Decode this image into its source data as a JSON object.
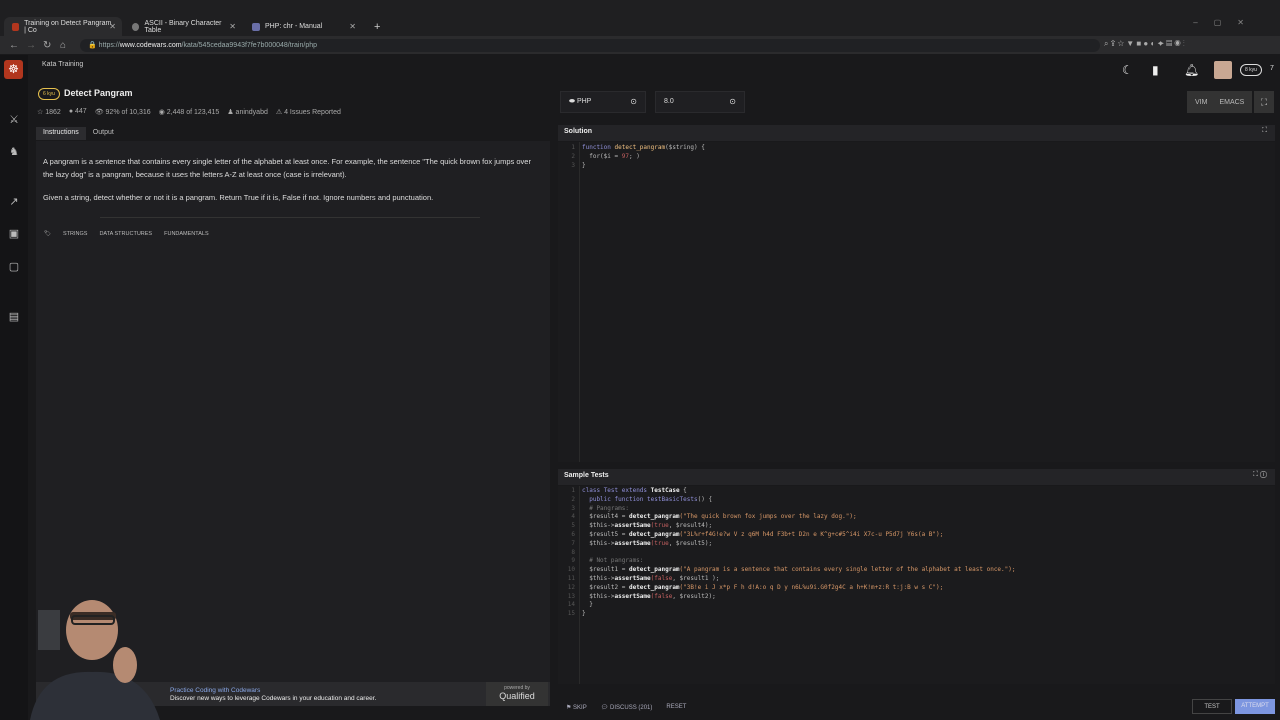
{
  "browser": {
    "tabs": [
      {
        "title": "Training on Detect Pangram | Co"
      },
      {
        "title": "ASCII - Binary Character Table"
      },
      {
        "title": "PHP: chr - Manual"
      }
    ],
    "url_prefix": "https://",
    "url_host": "www.codewars.com",
    "url_path": "/kata/545cedaa9943f7fe7b000048/train/php"
  },
  "header": {
    "section": "Kata Training",
    "user_rank": "8 kyu",
    "honor": "7"
  },
  "kata": {
    "rank": "6 kyu",
    "title": "Detect Pangram",
    "stars": "1862",
    "votes": "447",
    "satisfaction": "92% of 10,316",
    "completed": "2,448 of 123,415",
    "author": "anindyabd",
    "issues": "4 Issues Reported"
  },
  "left_tabs": [
    "Instructions",
    "Output"
  ],
  "description": [
    "A pangram is a sentence that contains every single letter of the alphabet at least once. For example, the sentence \"The quick brown fox jumps over the lazy dog\" is a pangram, because it uses the letters A-Z at least once (case is irrelevant).",
    "Given a string, detect whether or not it is a pangram. Return True if it is, False if not. Ignore numbers and punctuation."
  ],
  "tags": [
    "STRINGS",
    "DATA STRUCTURES",
    "FUNDAMENTALS"
  ],
  "promo": {
    "title": "Practice Coding with Codewars",
    "subtitle": "Discover new ways to leverage Codewars in your education and career.",
    "powered": "powered by",
    "brand": "Qualified"
  },
  "editor": {
    "language": "PHP",
    "version": "8.0",
    "modes": [
      "VIM",
      "EMACS"
    ]
  },
  "solution": {
    "title": "Solution",
    "lines": [
      [
        {
          "t": "function ",
          "k": "kw"
        },
        {
          "t": "detect_pangram",
          "k": "fn"
        },
        {
          "t": "($string) {",
          "k": "var"
        }
      ],
      [
        {
          "t": "  for($i = ",
          "k": "var"
        },
        {
          "t": "97",
          "k": "num"
        },
        {
          "t": "; )",
          "k": "var"
        }
      ],
      [
        {
          "t": "}",
          "k": "var"
        }
      ]
    ]
  },
  "tests": {
    "title": "Sample Tests",
    "lines": [
      [
        {
          "t": "class ",
          "k": "kw"
        },
        {
          "t": "Test ",
          "k": "kw"
        },
        {
          "t": "extends ",
          "k": "kw"
        },
        {
          "t": "TestCase",
          "k": "bold"
        },
        {
          "t": " {",
          "k": "var"
        }
      ],
      [
        {
          "t": "  public function ",
          "k": "kw"
        },
        {
          "t": "testBasicTests",
          "k": "kw"
        },
        {
          "t": "() {",
          "k": "var"
        }
      ],
      [
        {
          "t": "  # Pangrams:",
          "k": "cm"
        }
      ],
      [
        {
          "t": "  $result4 = ",
          "k": "var"
        },
        {
          "t": "detect_pangram",
          "k": "bold"
        },
        {
          "t": "(\"The quick brown fox jumps over the lazy dog.\");",
          "k": "str"
        }
      ],
      [
        {
          "t": "  $this->",
          "k": "var"
        },
        {
          "t": "assertSame",
          "k": "bold"
        },
        {
          "t": "(true",
          "k": "bool"
        },
        {
          "t": ", $result4);",
          "k": "var"
        }
      ],
      [
        {
          "t": "  $result5 = ",
          "k": "var"
        },
        {
          "t": "detect_pangram",
          "k": "bold"
        },
        {
          "t": "(\"3L%r+f4G!e?w V z q6M h4d F3b+t D2n e K^g+c#5^i4i X7c-u P5d7j Y6s(a B\");",
          "k": "str"
        }
      ],
      [
        {
          "t": "  $this->",
          "k": "var"
        },
        {
          "t": "assertSame",
          "k": "bold"
        },
        {
          "t": "(true",
          "k": "bool"
        },
        {
          "t": ", $result5);",
          "k": "var"
        }
      ],
      [
        {
          "t": "",
          "k": "var"
        }
      ],
      [
        {
          "t": "  # Not pangrams:",
          "k": "cm"
        }
      ],
      [
        {
          "t": "  $result1 = ",
          "k": "var"
        },
        {
          "t": "detect_pangram",
          "k": "bold"
        },
        {
          "t": "(\"A pangram is a sentence that contains every single letter of the alphabet at least once.\");",
          "k": "str"
        }
      ],
      [
        {
          "t": "  $this->",
          "k": "var"
        },
        {
          "t": "assertSame",
          "k": "bold"
        },
        {
          "t": "(false",
          "k": "bool"
        },
        {
          "t": ", $result1 );",
          "k": "var"
        }
      ],
      [
        {
          "t": "  $result2 = ",
          "k": "var"
        },
        {
          "t": "detect_pangram",
          "k": "bold"
        },
        {
          "t": "(\"3B!e i J x*p F h d!A:o q D y n6L%u9i.G0f2g4C a h+K!m+z:R t:j:B w s C\");",
          "k": "str"
        }
      ],
      [
        {
          "t": "  $this->",
          "k": "var"
        },
        {
          "t": "assertSame",
          "k": "bold"
        },
        {
          "t": "(false",
          "k": "bool"
        },
        {
          "t": ", $result2);",
          "k": "var"
        }
      ],
      [
        {
          "t": "  }",
          "k": "var"
        }
      ],
      [
        {
          "t": "}",
          "k": "var"
        }
      ]
    ]
  },
  "footer": {
    "skip": "SKIP",
    "discuss": "DISCUSS (201)",
    "reset": "RESET",
    "test": "TEST",
    "attempt": "ATTEMPT"
  }
}
